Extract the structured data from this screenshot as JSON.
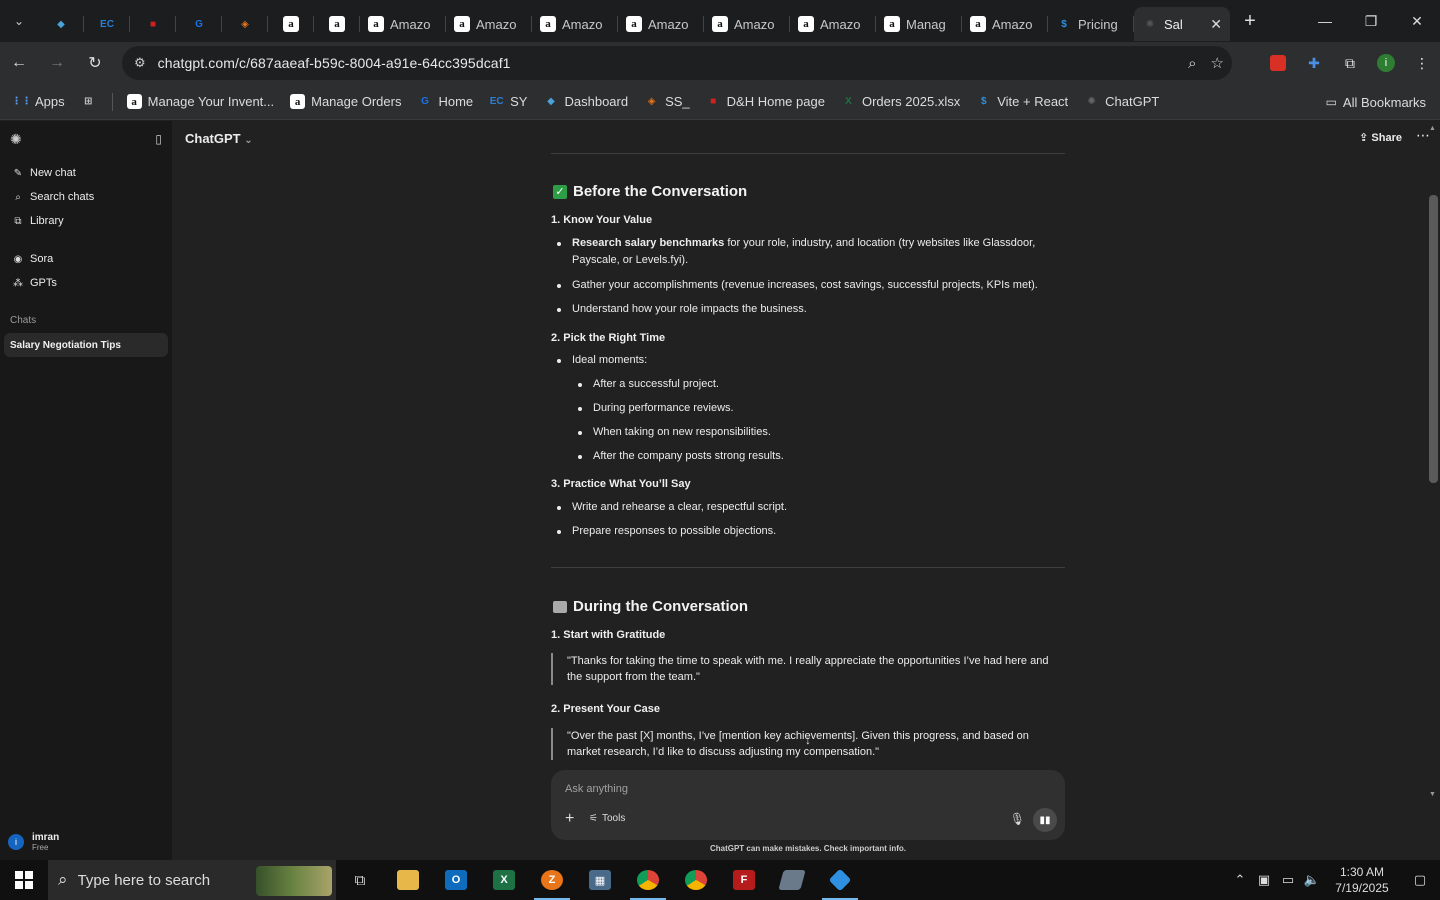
{
  "browser": {
    "tabs": [
      {
        "label": "",
        "fav": "◆",
        "favColor": "#4aa3d8"
      },
      {
        "label": "",
        "fav": "EC",
        "favColor": "#2a7fd4"
      },
      {
        "label": "",
        "fav": "■",
        "favColor": "#d21f1f"
      },
      {
        "label": "",
        "fav": "G",
        "favColor": "#1a73e8"
      },
      {
        "label": "",
        "fav": "◈",
        "favColor": "#e8751a"
      },
      {
        "label": "",
        "fav": "a",
        "amz": true
      },
      {
        "label": "",
        "fav": "a",
        "amz": true
      },
      {
        "label": "Amazo",
        "fav": "a",
        "amz": true
      },
      {
        "label": "Amazo",
        "fav": "a",
        "amz": true
      },
      {
        "label": "Amazo",
        "fav": "a",
        "amz": true
      },
      {
        "label": "Amazo",
        "fav": "a",
        "amz": true
      },
      {
        "label": "Amazo",
        "fav": "a",
        "amz": true
      },
      {
        "label": "Amazo",
        "fav": "a",
        "amz": true
      },
      {
        "label": "Manag",
        "fav": "a",
        "amz": true
      },
      {
        "label": "Amazo",
        "fav": "a",
        "amz": true
      },
      {
        "label": "Pricing",
        "fav": "$",
        "favColor": "#2f8fe0"
      },
      {
        "label": "Sal",
        "fav": "✺",
        "favColor": "#555",
        "active": true
      }
    ],
    "url": "chatgpt.com/c/687aaeaf-b59c-8004-a91e-64cc395dcaf1",
    "bookmarks": [
      {
        "label": "Apps",
        "icon": "⋮⋮",
        "color": "#5aa0ff"
      },
      {
        "label": "",
        "icon": "⊞",
        "color": "#ccc"
      },
      {
        "label": "Manage Your Invent...",
        "icon": "a",
        "amz": true
      },
      {
        "label": "Manage Orders",
        "icon": "a",
        "amz": true
      },
      {
        "label": "Home",
        "icon": "G",
        "color": "#1a73e8"
      },
      {
        "label": "SY",
        "icon": "EC",
        "color": "#2a7fd4"
      },
      {
        "label": "Dashboard",
        "icon": "◆",
        "color": "#4aa3d8"
      },
      {
        "label": "SS_",
        "icon": "◈",
        "color": "#e8751a"
      },
      {
        "label": "D&H Home page",
        "icon": "■",
        "color": "#d21f1f"
      },
      {
        "label": "Orders 2025.xlsx",
        "icon": "X",
        "color": "#1e7145"
      },
      {
        "label": "Vite + React",
        "icon": "$",
        "color": "#2f8fe0"
      },
      {
        "label": "ChatGPT",
        "icon": "✺",
        "color": "#666"
      }
    ],
    "all_bookmarks": "All Bookmarks"
  },
  "sidebar": {
    "items": [
      {
        "label": "New chat",
        "icon": "✎"
      },
      {
        "label": "Search chats",
        "icon": "⌕"
      },
      {
        "label": "Library",
        "icon": "⧉"
      }
    ],
    "items2": [
      {
        "label": "Sora",
        "icon": "◉"
      },
      {
        "label": "GPTs",
        "icon": "⁂"
      }
    ],
    "section_chats": "Chats",
    "active_chat": "Salary Negotiation Tips",
    "user_name": "imran",
    "user_plan": "Free",
    "avatar_letter": "i"
  },
  "main": {
    "model": "ChatGPT",
    "share": "Share",
    "section1_title": "Before the Conversation",
    "s1_h1": "1. Know Your Value",
    "s1_b1_bold": "Research salary benchmarks",
    "s1_b1_rest": " for your role, industry, and location (try websites like Glassdoor, Payscale, or Levels.fyi).",
    "s1_b2": "Gather your accomplishments (revenue increases, cost savings, successful projects, KPIs met).",
    "s1_b3": "Understand how your role impacts the business.",
    "s1_h2": "2. Pick the Right Time",
    "s1_b4": "Ideal moments:",
    "s1_sub": [
      "After a successful project.",
      "During performance reviews.",
      "When taking on new responsibilities.",
      "After the company posts strong results."
    ],
    "s1_h3": "3. Practice What You’ll Say",
    "s1_b5": "Write and rehearse a clear, respectful script.",
    "s1_b6": "Prepare responses to possible objections.",
    "section2_title": "During the Conversation",
    "s2_h1": "1. Start with Gratitude",
    "s2_q1": "\"Thanks for taking the time to speak with me. I really appreciate the opportunities I’ve had here and the support from the team.\"",
    "s2_h2": "2. Present Your Case",
    "s2_q2": "\"Over the past [X] months, I’ve [mention key achievements]. Given this progress, and based on market research, I’d like to discuss adjusting my compensation.\"",
    "composer_placeholder": "Ask anything",
    "tools": "Tools",
    "disclaimer": "ChatGPT can make mistakes. Check important info."
  },
  "taskbar": {
    "search_placeholder": "Type here to search",
    "time": "1:30 AM",
    "date": "7/19/2025"
  }
}
